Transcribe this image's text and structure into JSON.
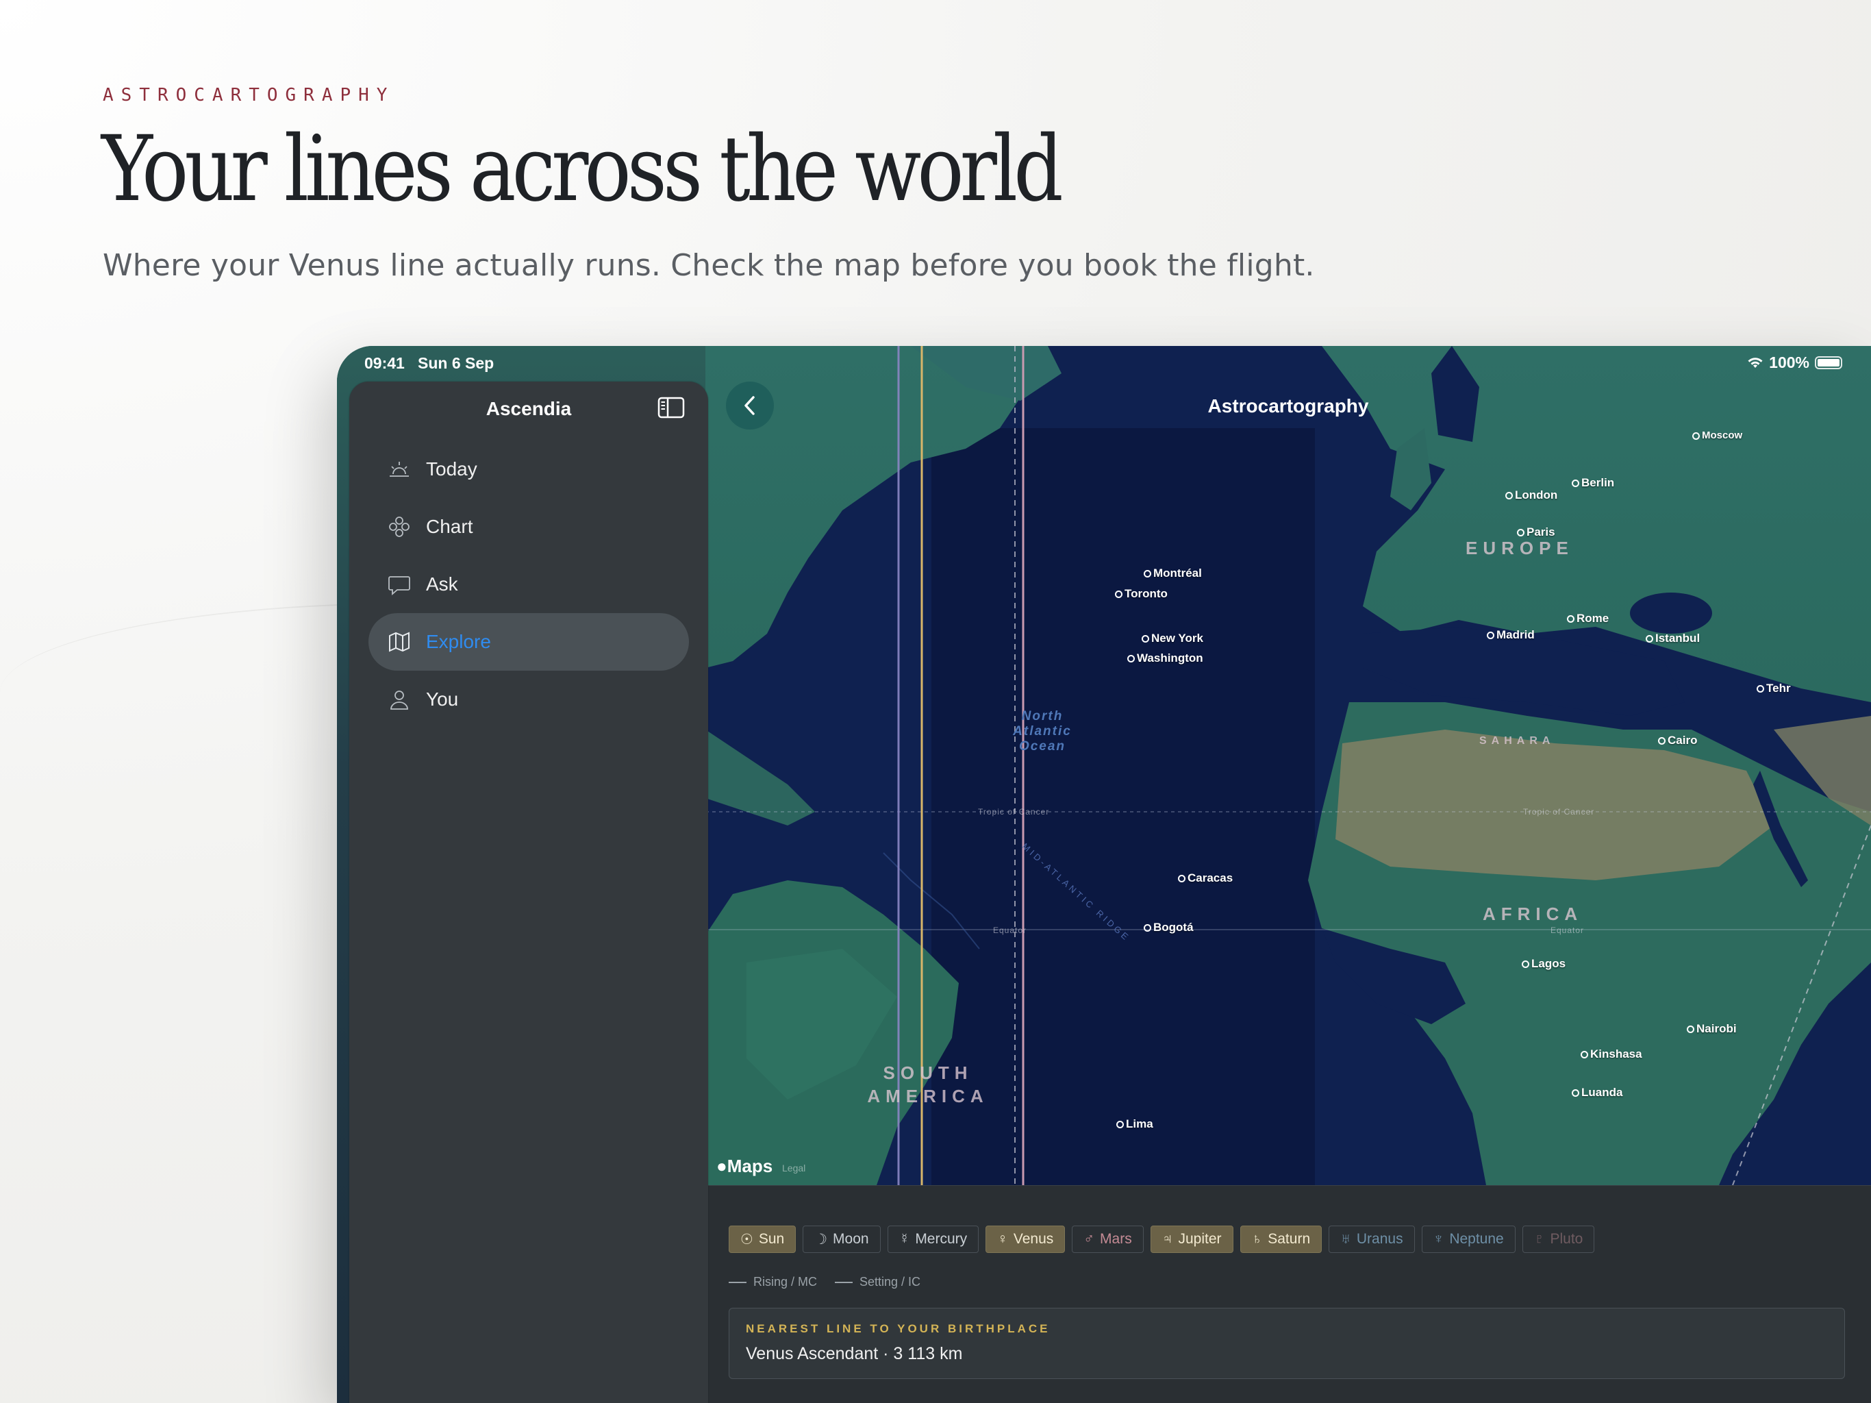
{
  "hero": {
    "eyebrow": "ASTROCARTOGRAPHY",
    "headline": "Your lines across the world",
    "subhead": "Where your Venus line actually runs. Check the map before you book the flight."
  },
  "status_bar": {
    "time": "09:41",
    "date": "Sun 6 Sep",
    "battery": "100%"
  },
  "sidebar": {
    "title": "Ascendia",
    "items": [
      {
        "label": "Today",
        "icon": "sunrise-icon",
        "active": false
      },
      {
        "label": "Chart",
        "icon": "chart-wheel-icon",
        "active": false
      },
      {
        "label": "Ask",
        "icon": "chat-bubble-icon",
        "active": false
      },
      {
        "label": "Explore",
        "icon": "map-icon",
        "active": true
      },
      {
        "label": "You",
        "icon": "person-icon",
        "active": false
      }
    ]
  },
  "map": {
    "title": "Astrocartography",
    "attribution": "Maps",
    "legal": "Legal",
    "ocean": "North Atlantic Ocean",
    "ridge": "MID-ATLANTIC RIDGE",
    "regions": {
      "europe": "EUROPE",
      "africa": "AFRICA",
      "south_america": "SOUTH AMERICA",
      "sahara": "SAHARA"
    },
    "labels": {
      "tropic": "Tropic of Cancer",
      "equator": "Equator"
    },
    "cities": {
      "moscow": "Moscow",
      "berlin": "Berlin",
      "london": "London",
      "paris": "Paris",
      "montreal": "Montréal",
      "toronto": "Toronto",
      "new_york": "New York",
      "washington": "Washington",
      "madrid": "Madrid",
      "rome": "Rome",
      "istanbul": "Istanbul",
      "tehran": "Tehr",
      "cairo": "Cairo",
      "caracas": "Caracas",
      "bogota": "Bogotá",
      "lagos": "Lagos",
      "nairobi": "Nairobi",
      "kinshasa": "Kinshasa",
      "luanda": "Luanda",
      "lima": "Lima"
    }
  },
  "planets": [
    {
      "label": "Sun",
      "glyph": "☉",
      "on": true
    },
    {
      "label": "Moon",
      "glyph": "☽",
      "on": false
    },
    {
      "label": "Mercury",
      "glyph": "☿",
      "on": false
    },
    {
      "label": "Venus",
      "glyph": "♀",
      "on": true
    },
    {
      "label": "Mars",
      "glyph": "♂",
      "on": false
    },
    {
      "label": "Jupiter",
      "glyph": "♃",
      "on": true
    },
    {
      "label": "Saturn",
      "glyph": "♄",
      "on": true
    },
    {
      "label": "Uranus",
      "glyph": "♅",
      "on": false
    },
    {
      "label": "Neptune",
      "glyph": "♆",
      "on": false
    },
    {
      "label": "Pluto",
      "glyph": "♇",
      "on": false
    }
  ],
  "legend": {
    "rising": "Rising / MC",
    "setting": "Setting / IC"
  },
  "nearest": {
    "label": "NEAREST LINE TO YOUR BIRTHPLACE",
    "value": "Venus Ascendant · 3 113 km"
  },
  "colors": {
    "accent": "#2f8cf0",
    "eyebrow": "#8e2f3c",
    "nearest_label": "#d4b456",
    "chip_on": "#6b6247"
  }
}
